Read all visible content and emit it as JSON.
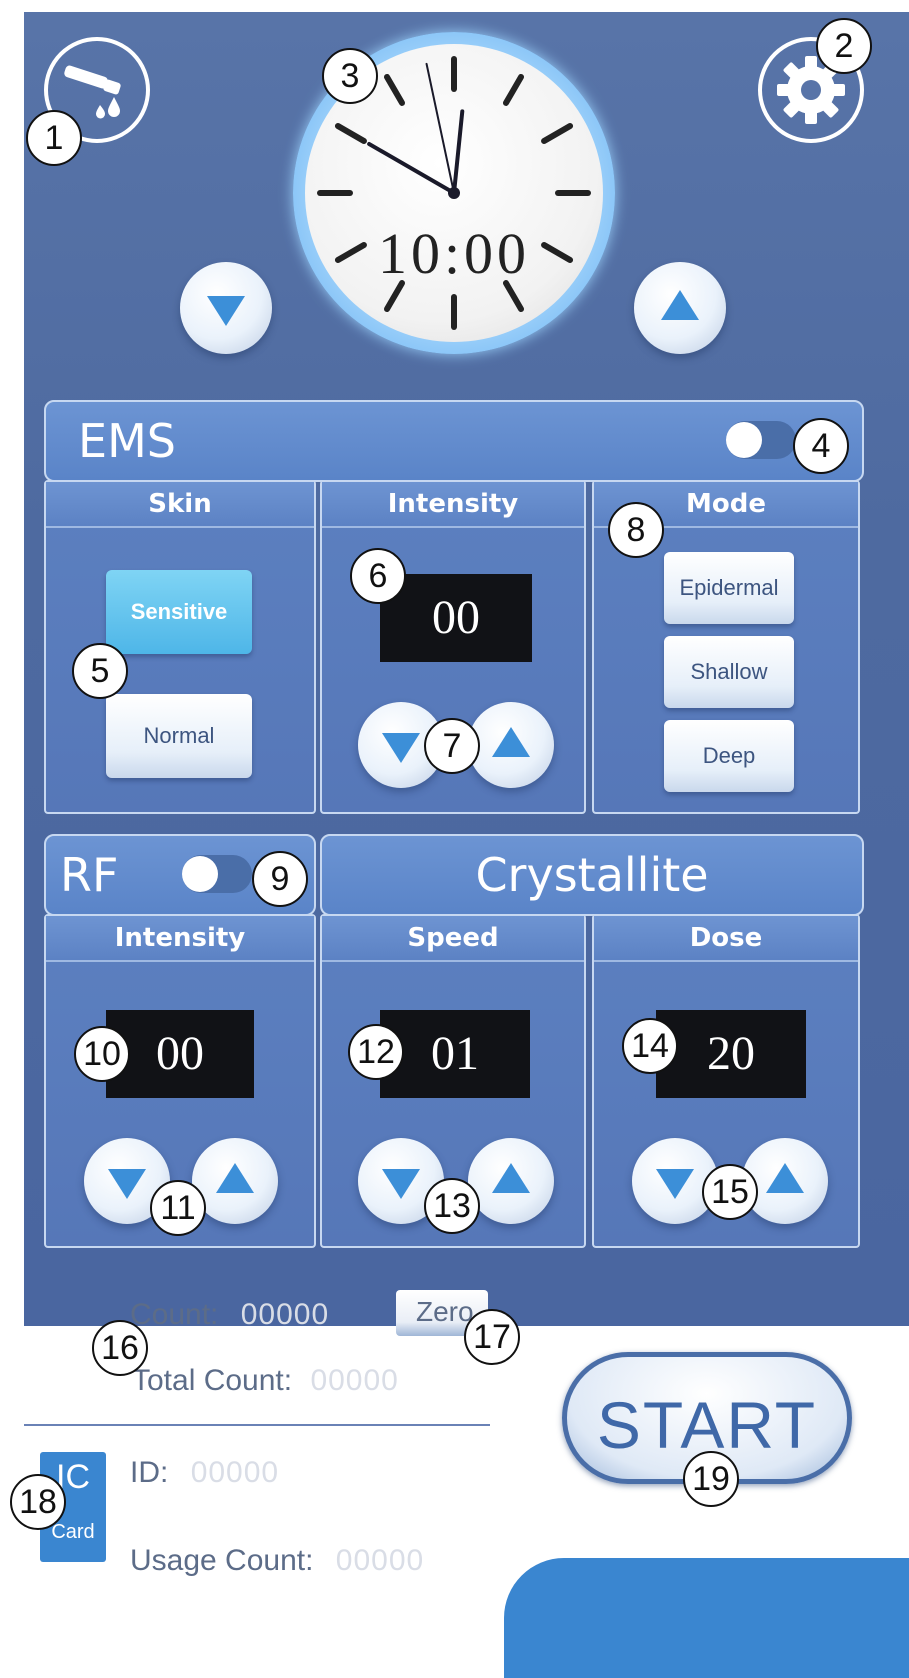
{
  "clock": {
    "time": "10:00",
    "hour": 10,
    "minute": 0,
    "second": 58
  },
  "ems": {
    "title": "EMS",
    "toggle_on": false,
    "skin": {
      "title": "Skin",
      "options": [
        "Sensitive",
        "Normal"
      ],
      "selected": "Sensitive"
    },
    "intensity": {
      "title": "Intensity",
      "value": "00"
    },
    "mode": {
      "title": "Mode",
      "options": [
        "Epidermal",
        "Shallow",
        "Deep"
      ]
    }
  },
  "rf": {
    "title": "RF",
    "toggle_on": false,
    "intensity": {
      "title": "Intensity",
      "value": "00"
    }
  },
  "crystallite": {
    "title": "Crystallite",
    "speed": {
      "title": "Speed",
      "value": "01"
    },
    "dose": {
      "title": "Dose",
      "value": "20"
    }
  },
  "counters": {
    "count_label": "Count:",
    "count_value": "00000",
    "zero_label": "Zero",
    "total_label": "Total Count:",
    "total_value": "00000"
  },
  "card": {
    "ic_label": "IC",
    "card_label": "Card",
    "id_label": "ID:",
    "id_value": "00000",
    "usage_label": "Usage Count:",
    "usage_value": "00000"
  },
  "start_label": "START",
  "callouts": [
    "1",
    "2",
    "3",
    "4",
    "5",
    "6",
    "7",
    "8",
    "9",
    "10",
    "11",
    "12",
    "13",
    "14",
    "15",
    "16",
    "17",
    "18",
    "19"
  ],
  "colors": {
    "background": "#4e6aa0",
    "accent": "#3c8fd8",
    "lcd": "#111216",
    "active_option": "#4eb6e8"
  }
}
